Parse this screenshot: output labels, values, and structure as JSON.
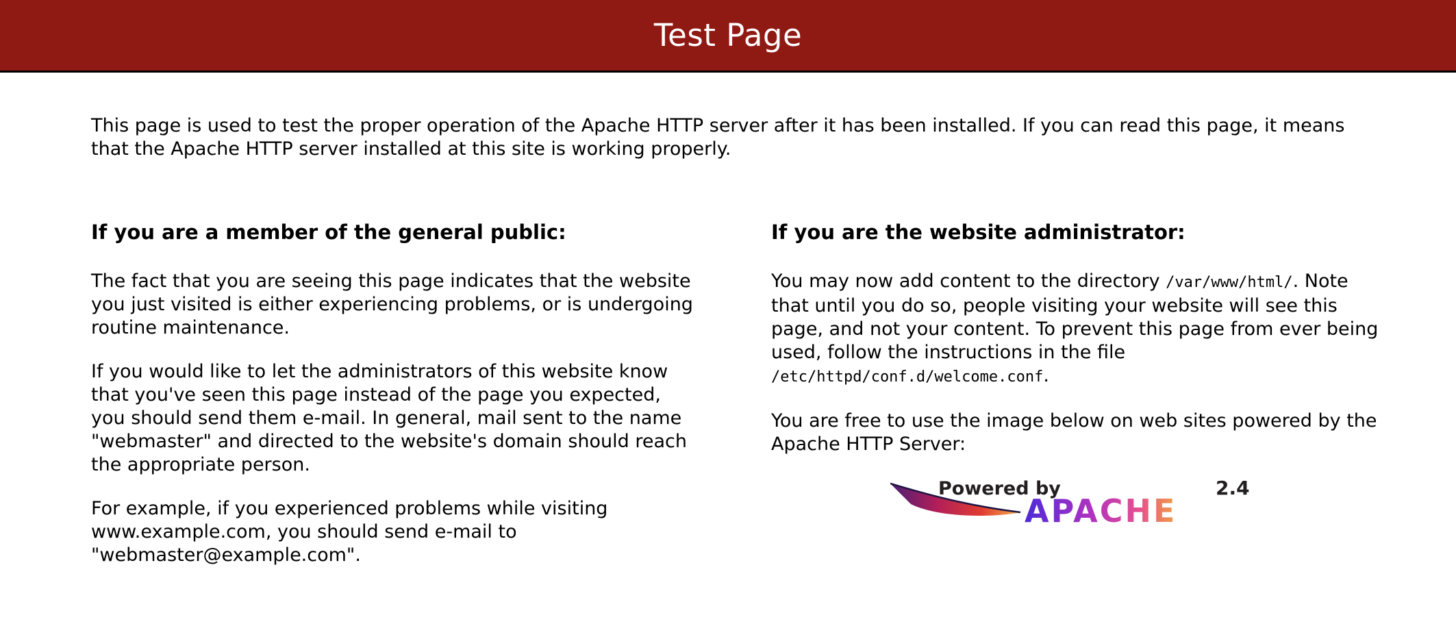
{
  "header": {
    "title": "Test Page",
    "background_color": "#8f1913"
  },
  "intro": {
    "text": "This page is used to test the proper operation of the Apache HTTP server after it has been installed. If you can read this page, it means that the Apache HTTP server installed at this site is working properly."
  },
  "public_section": {
    "heading": "If you are a member of the general public:",
    "paragraphs": [
      "The fact that you are seeing this page indicates that the website you just visited is either experiencing problems, or is undergoing routine maintenance.",
      "If you would like to let the administrators of this website know that you've seen this page instead of the page you expected, you should send them e-mail. In general, mail sent to the name \"webmaster\" and directed to the website's domain should reach the appropriate person.",
      "For example, if you experienced problems while visiting www.example.com, you should send e-mail to \"webmaster@example.com\"."
    ]
  },
  "admin_section": {
    "heading": "If you are the website administrator:",
    "p1_before": "You may now add content to the directory ",
    "p1_dir": "/var/www/html/",
    "p1_middle": ". Note that until you do so, people visiting your website will see this page, and not your content. To prevent this page from ever being used, follow the instructions in the file ",
    "p1_file": "/etc/httpd/conf.d/welcome.conf",
    "p1_after": ".",
    "p2": "You are free to use the image below on web sites powered by the Apache HTTP Server:"
  },
  "badge": {
    "powered_by": "Powered by",
    "version": "2.4",
    "brand": "APACHE",
    "icon": "apache-feather-icon"
  }
}
